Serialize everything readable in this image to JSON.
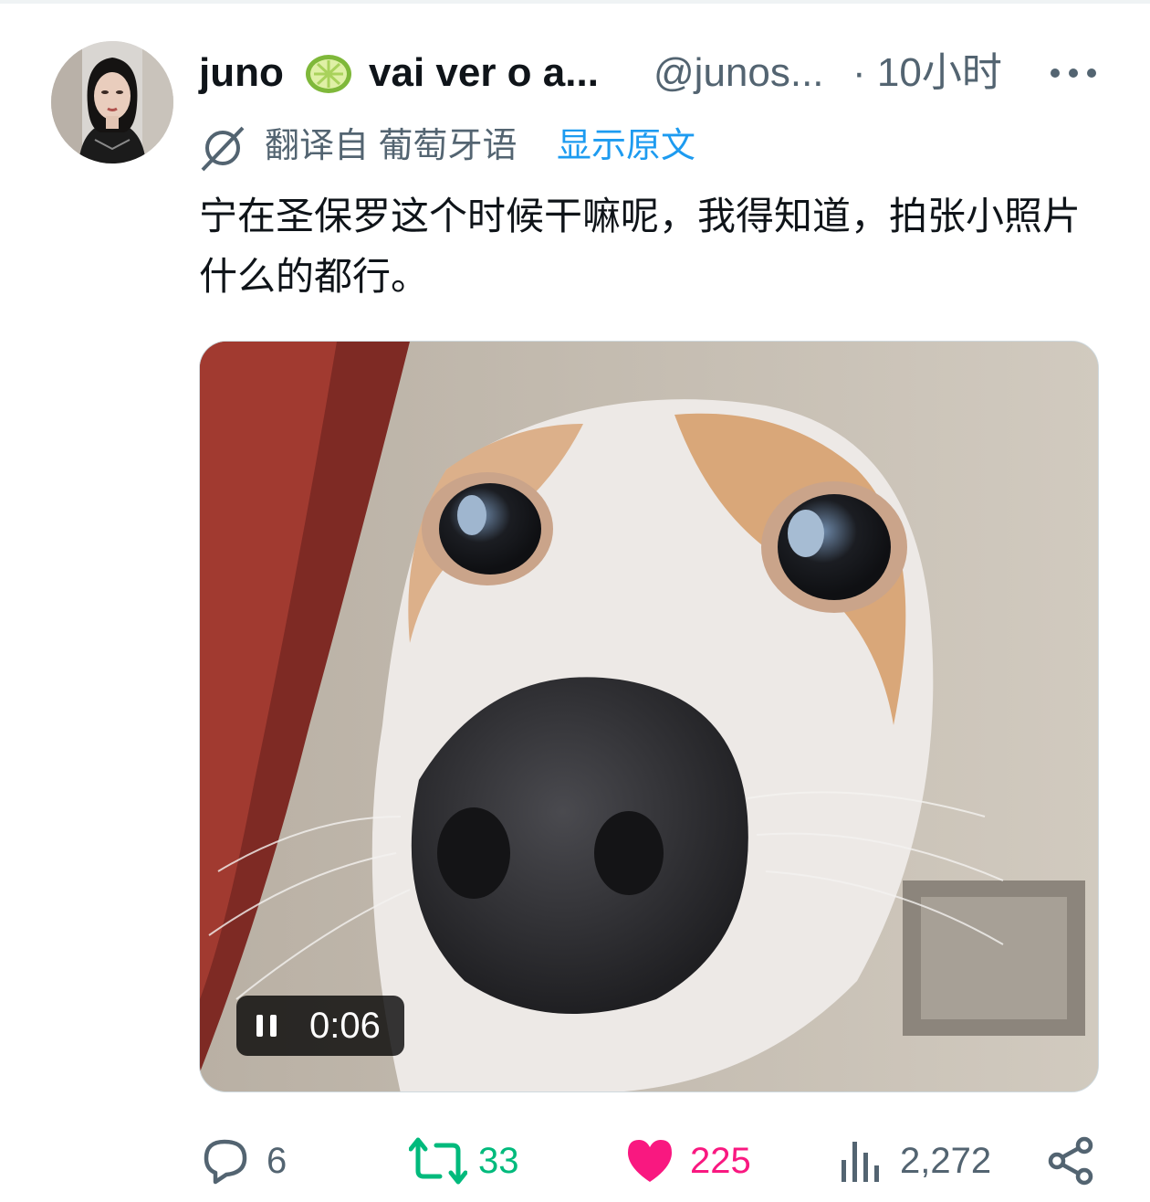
{
  "tweet": {
    "display_name": "juno",
    "display_name_suffix": "vai ver o a...",
    "handle": "@junos...",
    "separator": "·",
    "time": "10小时",
    "translated_from": "翻译自 葡萄牙语",
    "show_original": "显示原文",
    "text": "宁在圣保罗这个时候干嘛呢，我得知道，拍张小照片什么的都行。"
  },
  "media": {
    "duration": "0:06",
    "state": "playing"
  },
  "actions": {
    "replies": "6",
    "retweets": "33",
    "likes": "225",
    "views": "2,272"
  },
  "colors": {
    "secondary_text": "#536471",
    "link": "#1d9bf0",
    "retweet_green": "#00ba7c",
    "like_pink": "#f91880"
  },
  "icons": [
    "more-icon",
    "translate-icon",
    "pause-icon",
    "reply-icon",
    "retweet-icon",
    "like-icon",
    "views-icon",
    "share-icon"
  ]
}
